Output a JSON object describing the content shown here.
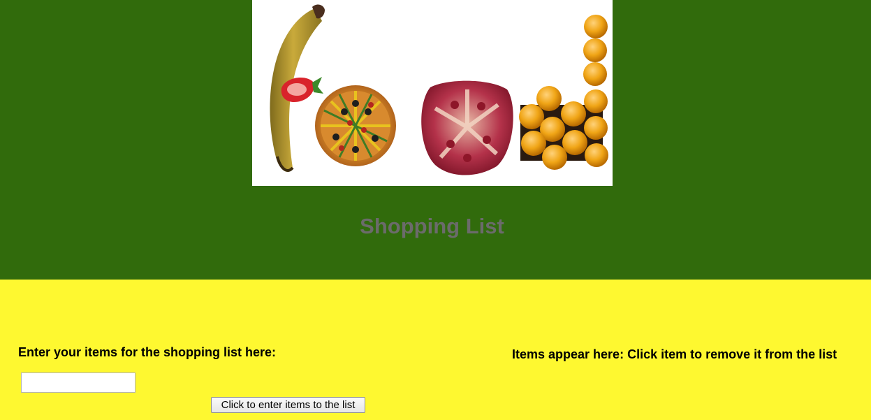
{
  "header": {
    "title": "Shopping List",
    "logo_alt": "Food"
  },
  "form": {
    "enter_label": "Enter your items for the shopping list here:",
    "input_value": "",
    "input_placeholder": "",
    "button_label": "Click to enter items to the list"
  },
  "list": {
    "heading": "Items appear here: Click item to remove it from the list",
    "items": []
  },
  "colors": {
    "header_bg": "#316b0c",
    "main_bg": "#fef830",
    "title_color": "#6b6b6b"
  }
}
